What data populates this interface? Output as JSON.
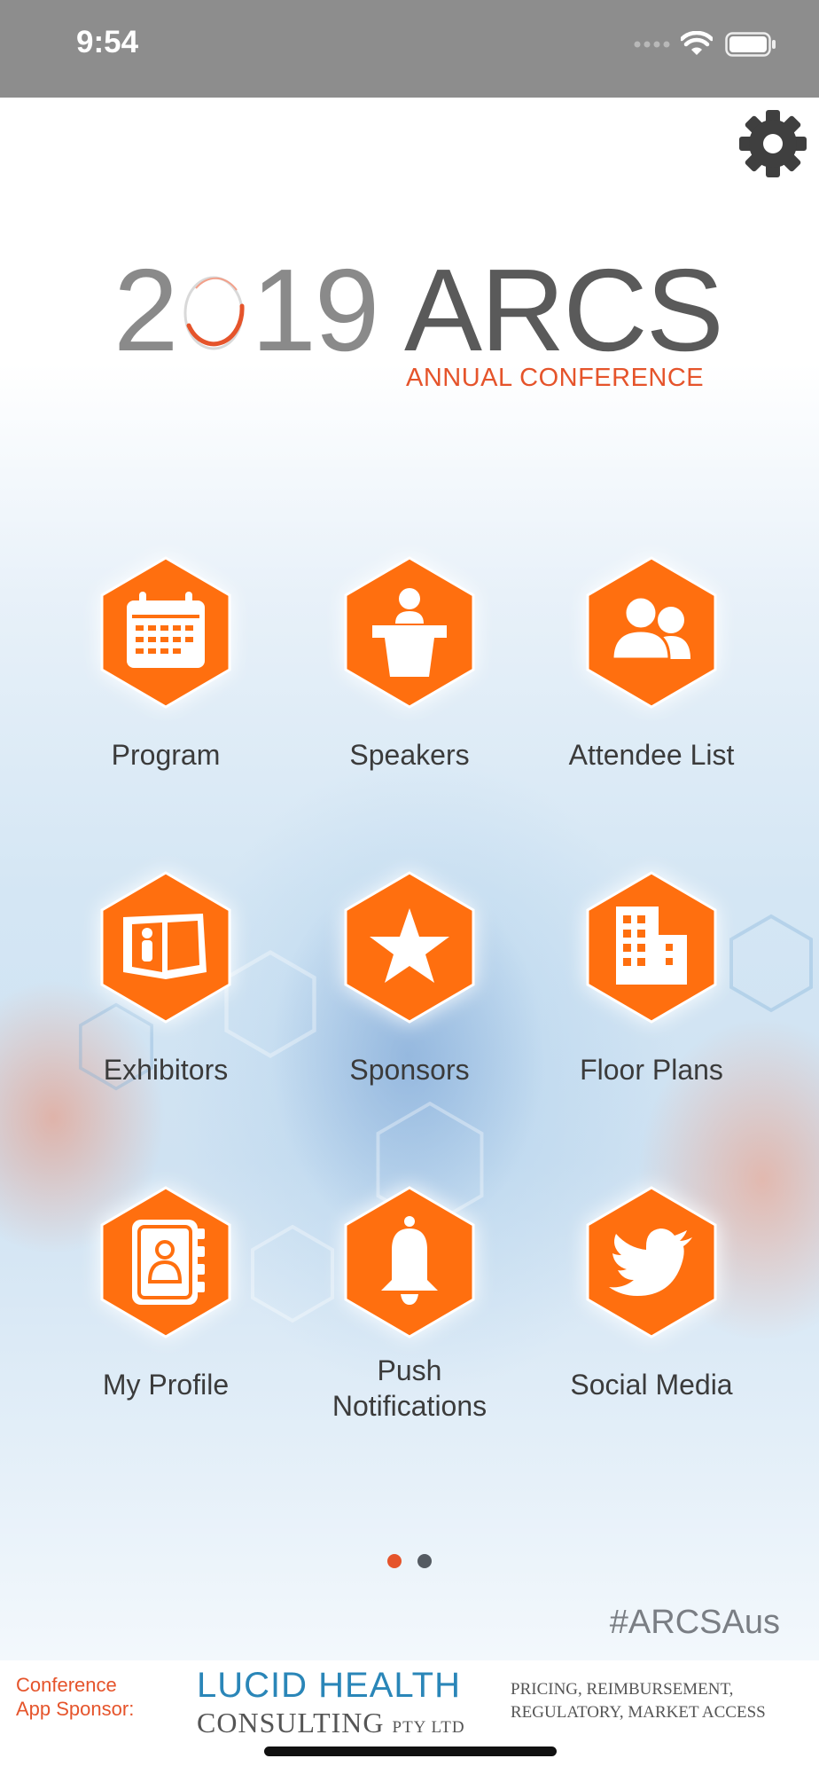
{
  "status_bar": {
    "time": "9:54",
    "icons": [
      "signal-icon",
      "wifi-icon",
      "battery-icon"
    ]
  },
  "header": {
    "settings_icon": "gear-icon"
  },
  "logo": {
    "year_prefix": "2",
    "year_suffix": "19",
    "name": "ARCS",
    "subtitle": "ANNUAL CONFERENCE"
  },
  "tiles": [
    {
      "label": "Program",
      "icon": "calendar-icon"
    },
    {
      "label": "Speakers",
      "icon": "podium-icon"
    },
    {
      "label": "Attendee List",
      "icon": "people-icon"
    },
    {
      "label": "Exhibitors",
      "icon": "booth-icon"
    },
    {
      "label": "Sponsors",
      "icon": "star-icon"
    },
    {
      "label": "Floor Plans",
      "icon": "building-icon"
    },
    {
      "label": "My Profile",
      "icon": "contact-book-icon"
    },
    {
      "label": "Push\nNotifications",
      "icon": "bell-icon"
    },
    {
      "label": "Social Media",
      "icon": "twitter-bird-icon"
    }
  ],
  "pagination": {
    "pages": 2,
    "current": 1
  },
  "hashtag": "#ARCSAus",
  "sponsor": {
    "label": "Conference App Sponsor:",
    "name_line1": "LUCID HEALTH",
    "name_line2": "CONSULTING",
    "name_suffix": "PTY LTD",
    "tagline_line1": "PRICING, REIMBURSEMENT,",
    "tagline_line2": "REGULATORY, MARKET ACCESS"
  },
  "colors": {
    "accent": "#FF6F0F",
    "brand_red": "#E5542B",
    "status_bar": "#8D8D8D",
    "sponsor_blue": "#2A86B8"
  }
}
